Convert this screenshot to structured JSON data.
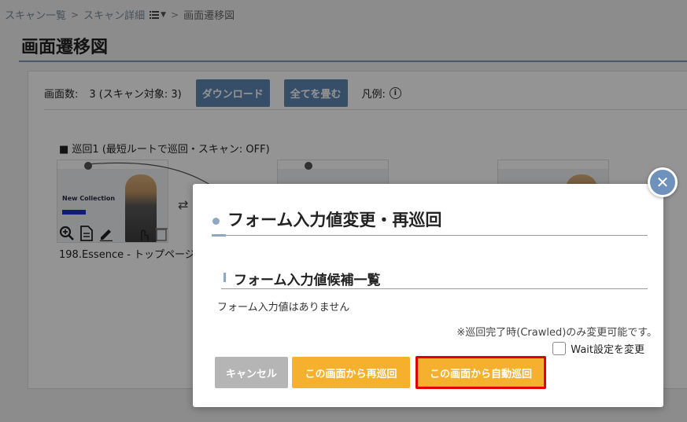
{
  "breadcrumb": {
    "items": [
      "スキャン一覧",
      "スキャン詳細",
      "画面遷移図"
    ],
    "separator": ">"
  },
  "page": {
    "title": "画面遷移図"
  },
  "toolbar": {
    "screen_count_label": "画面数:",
    "screen_count_value": "3 (スキャン対象: 3)",
    "download_label": "ダウンロード",
    "collapse_all_label": "全てを畳む",
    "legend_label": "凡例:"
  },
  "route": {
    "label": "■ 巡回1 (最短ルートで巡回・スキャン: OFF)"
  },
  "thumbnail": {
    "hero_text": "New Collection",
    "caption": "198.Essence - トップページ"
  },
  "modal": {
    "title": "フォーム入力値変更・再巡回",
    "section_title": "フォーム入力値候補一覧",
    "empty_message": "フォーム入力値はありません",
    "note": "※巡回完了時(Crawled)のみ変更可能です。",
    "wait_checkbox_label": "Wait設定を変更",
    "wait_checked": false,
    "buttons": {
      "cancel": "キャンセル",
      "recrawl": "この画面から再巡回",
      "auto_crawl": "この画面から自動巡回"
    }
  },
  "colors": {
    "accent": "#5f87b5",
    "warning": "#f5b02e",
    "highlight_border": "#e00000",
    "overlay": "rgba(0,0,0,0.42)"
  }
}
